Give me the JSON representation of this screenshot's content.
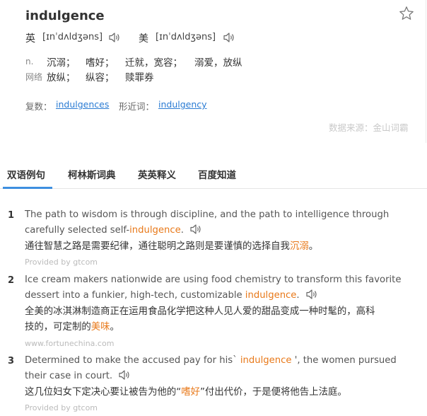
{
  "word": "indulgence",
  "phonetics": [
    {
      "label": "英",
      "text": "[ɪnˈdʌldʒəns]"
    },
    {
      "label": "美",
      "text": "[ɪnˈdʌldʒəns]"
    }
  ],
  "definitions": [
    {
      "pos": "n.",
      "meanings": [
        "沉溺；",
        "嗜好；",
        "迁就，宽容；",
        "溺爱，放纵"
      ]
    },
    {
      "pos": "网络",
      "meanings": [
        "放纵；",
        "纵容；",
        "赎罪券"
      ]
    }
  ],
  "forms": [
    {
      "label": "复数：",
      "value": "indulgences"
    },
    {
      "label": "形近词：",
      "value": "indulgency"
    }
  ],
  "source": "数据来源：金山词霸",
  "tabs": [
    "双语例句",
    "柯林斯词典",
    "英英释义",
    "百度知道"
  ],
  "examples": [
    {
      "num": "1",
      "en_line1": "The path to wisdom is through discipline, and the path to intelligence through",
      "en_line2_pre": "carefully selected self-",
      "en_hl": "indulgence",
      "en_line2_post": ".",
      "cn_pre": "通往智慧之路是需要纪律，通往聪明之路则是要谨慎的选择自我",
      "cn_hl": "沉溺",
      "cn_post": "。",
      "provider": "Provided by gtcom"
    },
    {
      "num": "2",
      "en_line1": "Ice cream makers nationwide are using food chemistry to transform this favorite",
      "en_line2_pre": "dessert into a funkier, high-tech, customizable ",
      "en_hl": "indulgence",
      "en_line2_post": ".",
      "cn_line1": "全美的冰淇淋制造商正在运用食品化学把这种人见人爱的甜品变成一种时髦的，高科",
      "cn_pre": "技的，可定制的",
      "cn_hl": "美味",
      "cn_post": "。",
      "provider": "www.fortunechina.com"
    },
    {
      "num": "3",
      "en_line1_pre": "Determined to make the accused pay for his` ",
      "en_hl": "indulgence",
      "en_line1_post": " ', the women pursued",
      "en_line2": "their case in court.",
      "cn_pre": "这几位妇女下定决心要让被告为他的“",
      "cn_hl": "嗜好",
      "cn_post": "”付出代价，于是便将他告上法庭。",
      "provider": "Provided by gtcom"
    }
  ]
}
